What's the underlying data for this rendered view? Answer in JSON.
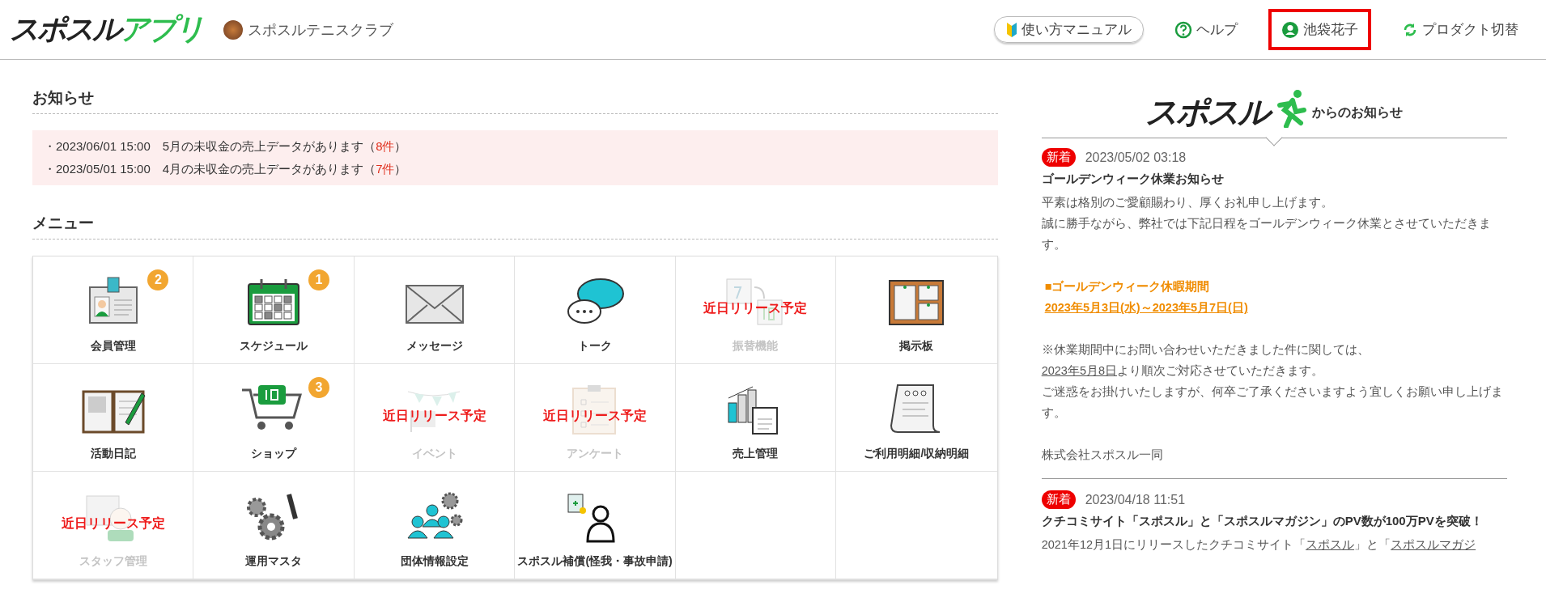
{
  "header": {
    "logo": {
      "text": "スポスル",
      "accent": "アプリ"
    },
    "club": "スポスルテニスクラブ",
    "nav": [
      {
        "kind": "manual",
        "label": "使い方マニュアル",
        "highlighted": false
      },
      {
        "kind": "help",
        "label": "ヘルプ",
        "highlighted": false
      },
      {
        "kind": "user",
        "label": "池袋花子",
        "highlighted": true
      },
      {
        "kind": "switch",
        "label": "プロダクト切替",
        "highlighted": false
      }
    ]
  },
  "notices": {
    "title": "お知らせ",
    "items": [
      {
        "text": "・2023/06/01 15:00　5月の未収金の売上データがあります（",
        "count": "8件",
        "close": "）"
      },
      {
        "text": "・2023/05/01 15:00　4月の未収金の売上データがあります（",
        "count": "7件",
        "close": "）"
      }
    ]
  },
  "menu": {
    "title": "メニュー",
    "items": [
      {
        "label": "会員管理",
        "badge": "2",
        "disabled": false
      },
      {
        "label": "スケジュール",
        "badge": "1",
        "disabled": false
      },
      {
        "label": "メッセージ",
        "disabled": false
      },
      {
        "label": "トーク",
        "disabled": false
      },
      {
        "label": "振替機能",
        "disabled": true,
        "notice": "近日リリース予定"
      },
      {
        "label": "掲示板",
        "disabled": false
      },
      {
        "label": "活動日記",
        "disabled": false
      },
      {
        "label": "ショップ",
        "badge": "3",
        "disabled": false
      },
      {
        "label": "イベント",
        "disabled": true,
        "notice": "近日リリース予定"
      },
      {
        "label": "アンケート",
        "disabled": true,
        "notice": "近日リリース予定"
      },
      {
        "label": "売上管理",
        "disabled": false
      },
      {
        "label": "ご利用明細/収納明細",
        "disabled": false
      },
      {
        "label": "スタッフ管理",
        "disabled": true,
        "notice": "近日リリース予定"
      },
      {
        "label": "運用マスタ",
        "disabled": false
      },
      {
        "label": "団体情報設定",
        "disabled": false
      },
      {
        "label": "スポスル補償(怪我・事故申請)",
        "disabled": false
      }
    ]
  },
  "news": {
    "logo": "スポスル",
    "heading": "からのお知らせ",
    "items": [
      {
        "badge": "新着",
        "date": "2023/05/02 03:18",
        "title": "ゴールデンウィーク休業お知らせ",
        "blocks": [
          [
            {
              "kind": "text",
              "runs": [
                {
                  "text": "平素は格別のご愛顧賜わり、厚くお礼申し上げます。",
                  "link": false
                }
              ]
            },
            {
              "kind": "text",
              "runs": [
                {
                  "text": "誠に勝手ながら、弊社では下記日程をゴールデンウィーク休業とさせていただきます。",
                  "link": false
                }
              ]
            }
          ],
          [
            {
              "kind": "accent",
              "runs": [
                {
                  "text": "■ゴールデンウィーク休暇期間",
                  "link": false
                }
              ]
            },
            {
              "kind": "accent",
              "runs": [
                {
                  "text": "2023年5月3日(水)～2023年5月7日(日)",
                  "link": true
                }
              ]
            }
          ],
          [
            {
              "kind": "text",
              "runs": [
                {
                  "text": "※休業期間中にお問い合わせいただきました件に関しては、",
                  "link": false
                }
              ]
            },
            {
              "kind": "text",
              "runs": [
                {
                  "text": "2023年5月8日",
                  "link": true
                },
                {
                  "text": "より順次ご対応させていただきます。",
                  "link": false
                }
              ]
            },
            {
              "kind": "text",
              "runs": [
                {
                  "text": "ご迷惑をお掛けいたしますが、何卒ご了承くださいますよう宜しくお願い申し上げます。",
                  "link": false
                }
              ]
            }
          ],
          [
            {
              "kind": "text",
              "runs": [
                {
                  "text": "株式会社スポスル一同",
                  "link": false
                }
              ]
            }
          ]
        ]
      },
      {
        "badge": "新着",
        "date": "2023/04/18 11:51",
        "title": "クチコミサイト「スポスル」と「スポスルマガジン」のPV数が100万PVを突破！",
        "blocks": [
          [
            {
              "kind": "text",
              "runs": [
                {
                  "text": "2021年12月1日にリリースしたクチコミサイト「",
                  "link": false
                },
                {
                  "text": "スポスル",
                  "link": true
                },
                {
                  "text": "」と「",
                  "link": false
                },
                {
                  "text": "スポスルマガジ",
                  "link": true
                }
              ]
            }
          ]
        ]
      }
    ]
  }
}
